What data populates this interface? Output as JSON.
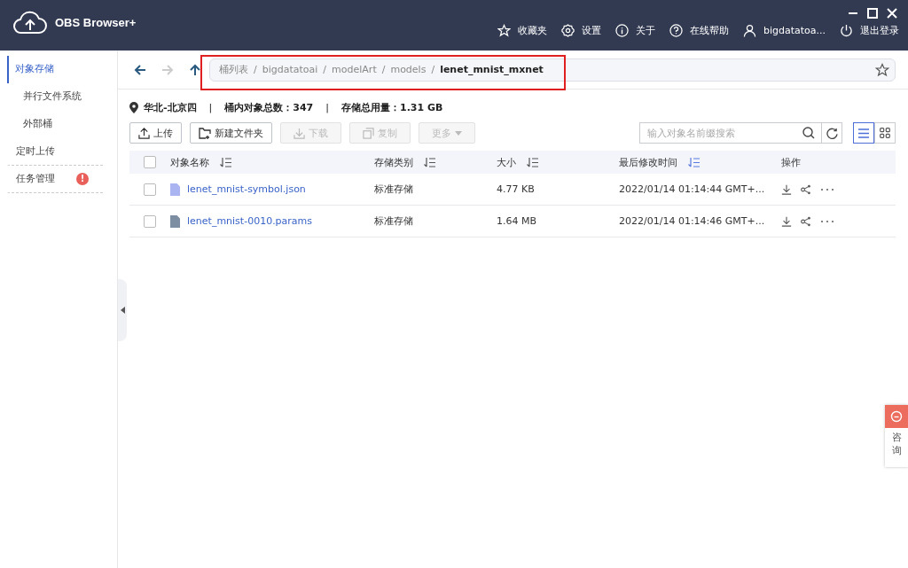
{
  "window": {
    "title": "OBS Browser+"
  },
  "header_menu": [
    {
      "label": "收藏夹"
    },
    {
      "label": "设置"
    },
    {
      "label": "关于"
    },
    {
      "label": "在线帮助"
    },
    {
      "label": "bigdatatoa..."
    },
    {
      "label": "退出登录"
    }
  ],
  "sidebar": {
    "items": [
      {
        "label": "对象存储",
        "selected": true
      },
      {
        "label": "并行文件系统",
        "selected": false
      },
      {
        "label": "外部桶",
        "selected": false
      },
      {
        "label": "定时上传",
        "selected": false
      },
      {
        "label": "任务管理",
        "selected": false,
        "badge": "!"
      }
    ]
  },
  "breadcrumb": [
    {
      "label": "桶列表",
      "current": false
    },
    {
      "separator": "/",
      "label": "bigdatatoai",
      "current": false
    },
    {
      "separator": "/",
      "label": "modelArt",
      "current": false
    },
    {
      "separator": "/",
      "label": "models",
      "current": false
    },
    {
      "separator": "/",
      "label": "lenet_mnist_mxnet",
      "current": true
    }
  ],
  "nav": {
    "back_disabled": false,
    "forward_disabled": true
  },
  "info": {
    "region": "华北-北京四",
    "divider_1": "|",
    "count_label": "桶内对象总数：",
    "count": "347",
    "divider_2": "|",
    "usage_label": "存储总用量：",
    "usage": "1.31 GB"
  },
  "toolbar": [
    {
      "label": "上传",
      "disabled": false
    },
    {
      "label": "新建文件夹",
      "disabled": false
    },
    {
      "label": "下载",
      "disabled": true
    },
    {
      "label": "复制",
      "disabled": true
    },
    {
      "label": "更多",
      "disabled": true
    }
  ],
  "search": {
    "placeholder": "输入对象名前缀搜索"
  },
  "view_modes": [
    {
      "kind": "list",
      "selected": true
    },
    {
      "kind": "grid",
      "selected": false
    }
  ],
  "table": {
    "all_checked": false,
    "columns": [
      {
        "label": "对象名称",
        "sort_active": false
      },
      {
        "label": "存储类别",
        "sort_active": false
      },
      {
        "label": "大小",
        "sort_active": false
      },
      {
        "label": "最后修改时间",
        "sort_active": true
      },
      {
        "label": "操作"
      }
    ],
    "rows": [
      {
        "name": "lenet_mnist-symbol.json",
        "kind": "json",
        "checked": false,
        "storage": "标准存储",
        "size": "4.77 KB",
        "modified": "2022/01/14 01:14:44 GMT+..."
      },
      {
        "name": "lenet_mnist-0010.params",
        "kind": "binary",
        "checked": false,
        "storage": "标准存储",
        "size": "1.64 MB",
        "modified": "2022/01/14 01:14:46 GMT+..."
      }
    ]
  },
  "consult": {
    "label": "咨询"
  }
}
